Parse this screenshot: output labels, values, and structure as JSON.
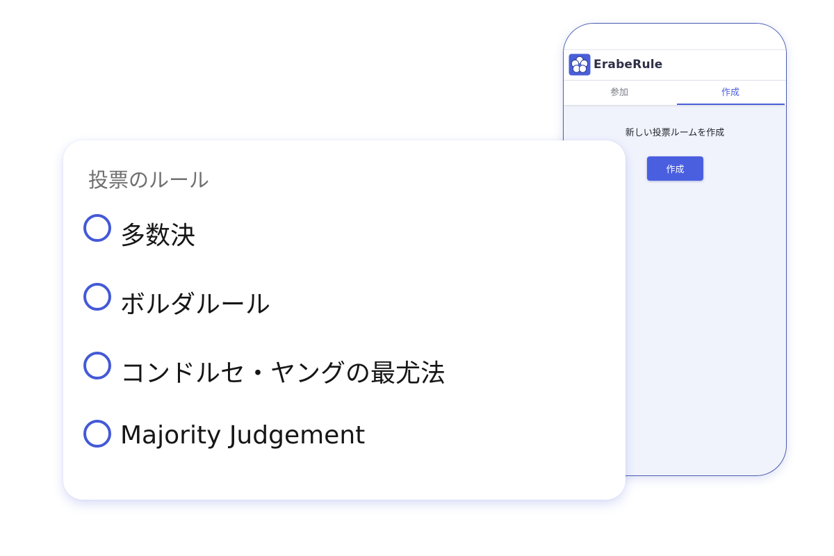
{
  "phone": {
    "app_name": "ErabeRule",
    "tabs": [
      {
        "label": "参加",
        "active": false
      },
      {
        "label": "作成",
        "active": true
      }
    ],
    "heading": "新しい投票ルームを作成",
    "create_button": "作成"
  },
  "card": {
    "title": "投票のルール",
    "rules": [
      {
        "label": "多数決",
        "selected": false
      },
      {
        "label": "ボルダルール",
        "selected": false
      },
      {
        "label": "コンドルセ・ヤングの最尤法",
        "selected": false
      },
      {
        "label": "Majority Judgement",
        "selected": false
      }
    ]
  },
  "colors": {
    "accent": "#4a5fd8",
    "radio_border": "#4459d6",
    "phone_background": "#f1f3fc",
    "phone_border": "#4a5bb0"
  },
  "icons": {
    "app_logo": "flower-logo-icon"
  }
}
